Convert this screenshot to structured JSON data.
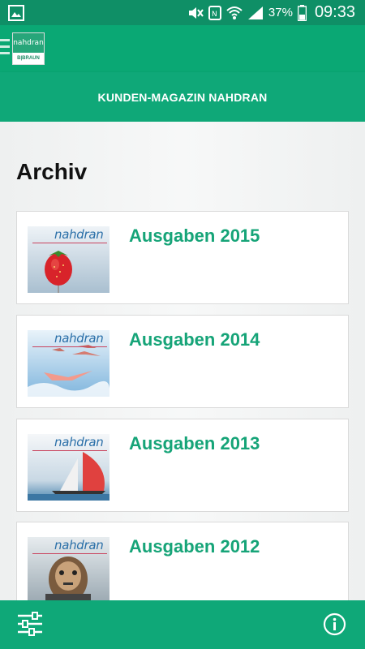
{
  "status_bar": {
    "battery_percent": "37%",
    "time": "09:33",
    "icons": [
      "image-icon",
      "mute-icon",
      "nfc-icon",
      "wifi-icon",
      "signal-icon",
      "battery-icon"
    ]
  },
  "header": {
    "logo_top": "nahdran",
    "logo_bottom": "B|BRAUN"
  },
  "title_bar": {
    "title": "KUNDEN-MAGAZIN NAHDRAN"
  },
  "main": {
    "page_title": "Archiv",
    "items": [
      {
        "label": "Ausgaben 2015",
        "cover_title": "nahdran",
        "cover_theme": "strawberry"
      },
      {
        "label": "Ausgaben 2014",
        "cover_title": "nahdran",
        "cover_theme": "flamingos"
      },
      {
        "label": "Ausgaben 2013",
        "cover_title": "nahdran",
        "cover_theme": "sailboat"
      },
      {
        "label": "Ausgaben 2012",
        "cover_title": "nahdran",
        "cover_theme": "robot"
      }
    ]
  },
  "colors": {
    "status_bar": "#0f8f66",
    "primary": "#0fa878",
    "accent_text": "#16a478"
  },
  "bottom_bar": {
    "left_icon": "sliders-icon",
    "right_icon": "info-icon"
  }
}
